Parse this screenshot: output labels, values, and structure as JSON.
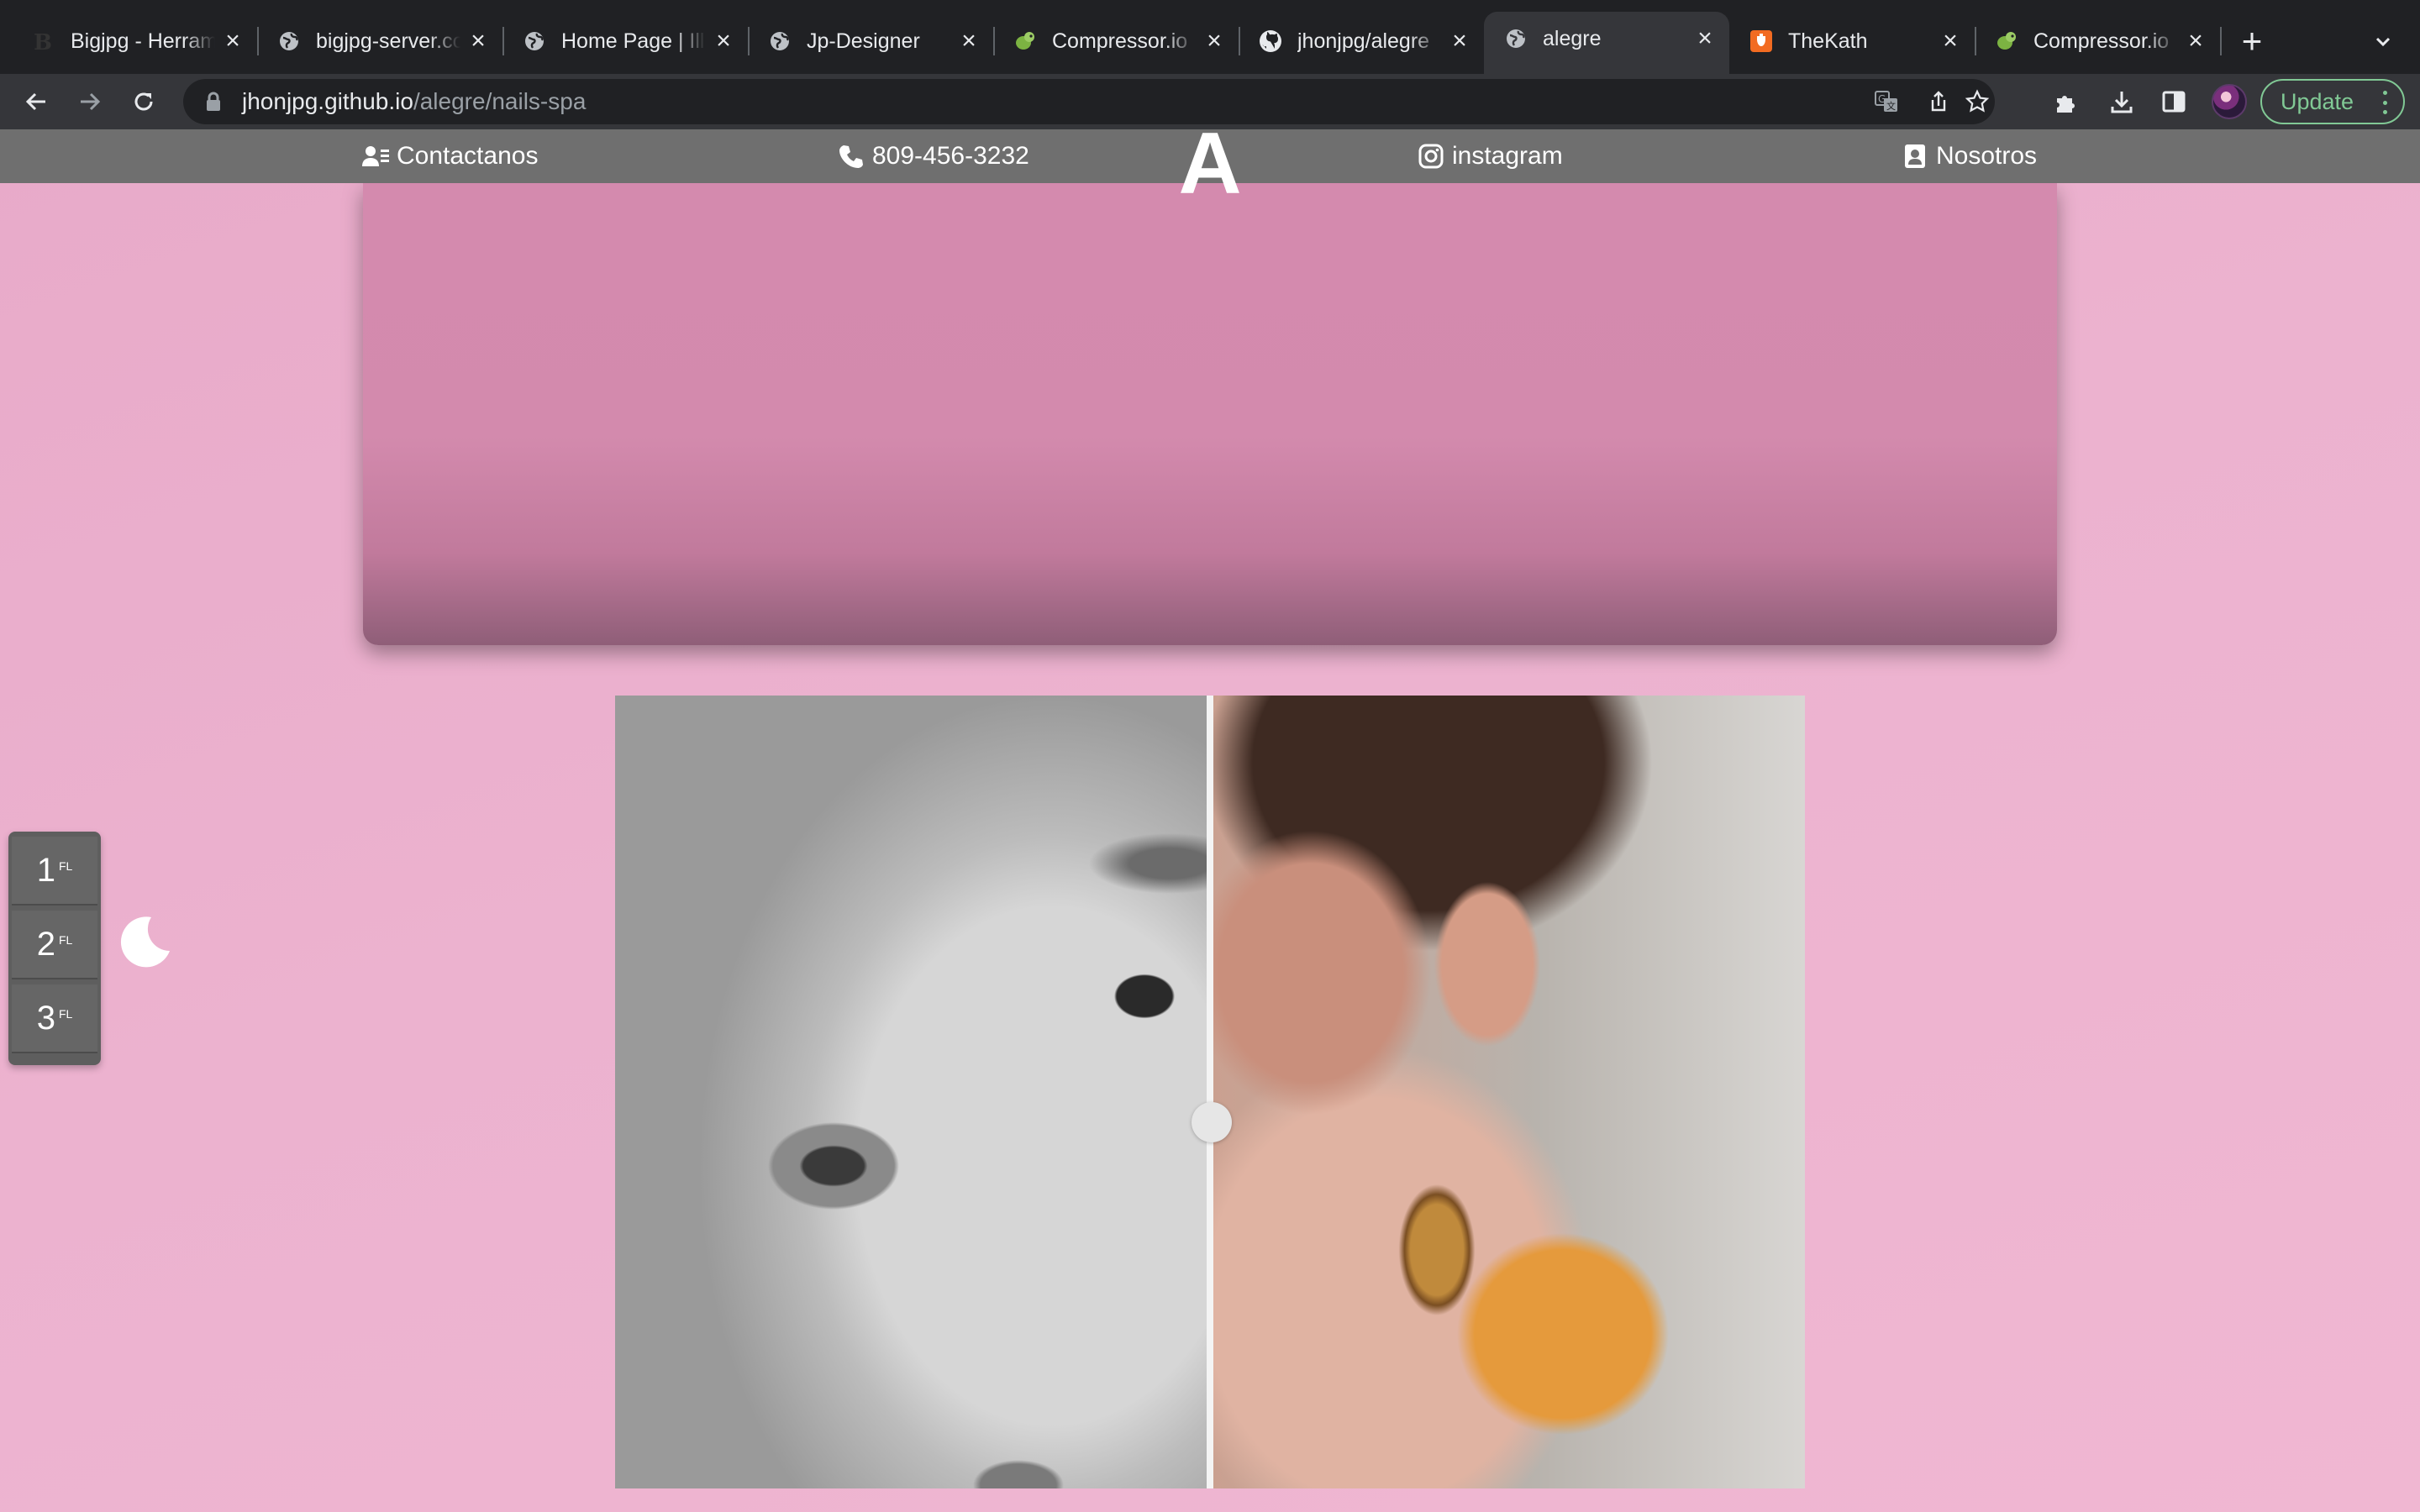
{
  "browser": {
    "tabs": [
      {
        "title": "Bigjpg - Herramienta",
        "favicon": "bigjpg-logo",
        "active": false
      },
      {
        "title": "bigjpg-server.com",
        "favicon": "globe-icon",
        "active": false
      },
      {
        "title": "Home Page | Illustrations",
        "favicon": "globe-icon",
        "active": false
      },
      {
        "title": "Jp-Designer",
        "favicon": "globe-icon",
        "active": false
      },
      {
        "title": "Compressor.io",
        "favicon": "compressor-logo",
        "active": false
      },
      {
        "title": "jhonjpg/alegre",
        "favicon": "github-icon",
        "active": false
      },
      {
        "title": "alegre",
        "favicon": "globe-icon",
        "active": true
      },
      {
        "title": "TheKath",
        "favicon": "thekath-logo",
        "active": false
      },
      {
        "title": "Compressor.io",
        "favicon": "compressor-logo",
        "active": false
      }
    ],
    "url_host": "jhonjpg.github.io",
    "url_path": "/alegre/nails-spa",
    "update_label": "Update"
  },
  "site": {
    "nav": {
      "contact_label": "Contactanos",
      "phone_label": "809-456-3232",
      "logo_text": "A",
      "instagram_label": "instagram",
      "about_label": "Nosotros"
    },
    "floors": [
      {
        "number": "1",
        "suffix": "FL"
      },
      {
        "number": "2",
        "suffix": "FL"
      },
      {
        "number": "3",
        "suffix": "FL"
      }
    ],
    "theme_toggle_icon": "moon-icon",
    "compare_split": 0.5
  },
  "colors": {
    "page_bg": "#ecb2cf",
    "nav_bg": "#6f6f6f",
    "hero_card": "#d38aad",
    "update_accent": "#81c995"
  }
}
